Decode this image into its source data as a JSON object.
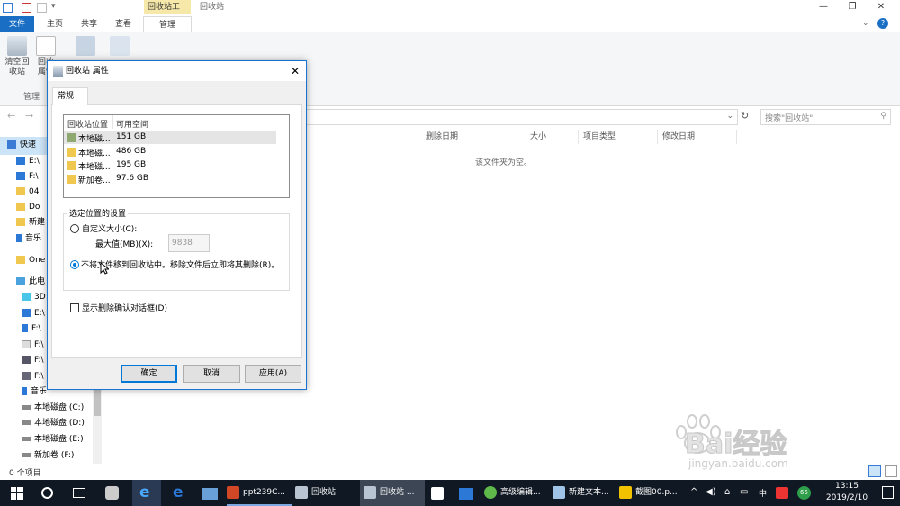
{
  "titlebar": {
    "context_tab": "回收站工具",
    "window_title": "回收站",
    "minimize": "—",
    "maximize": "❐",
    "close": "✕"
  },
  "ribbon_tabs": [
    {
      "label": "文件"
    },
    {
      "label": "主页"
    },
    {
      "label": "共享"
    },
    {
      "label": "查看"
    },
    {
      "label": "管理"
    }
  ],
  "ribbon": {
    "empty_recycle": "清空回收站",
    "empty_line1": "清空回",
    "empty_line2": "收站",
    "props_line1": "回收",
    "props_line2": "属性",
    "group_label": "管理"
  },
  "address": {
    "search_placeholder": "搜索\"回收站\""
  },
  "columns": [
    "删除日期",
    "大小",
    "项目类型",
    "修改日期"
  ],
  "empty_message": "该文件夹为空。",
  "nav": [
    {
      "label": "快速",
      "icon": "star-icon"
    },
    {
      "label": "E:\\",
      "icon": "drive-icon"
    },
    {
      "label": "F:\\",
      "icon": "drive-icon"
    },
    {
      "label": "04",
      "icon": "folder-icon"
    },
    {
      "label": "Do",
      "icon": "folder-icon"
    },
    {
      "label": "新建",
      "icon": "folder-icon"
    },
    {
      "label": "音乐",
      "icon": "music-icon"
    },
    {
      "label": "One",
      "icon": "folder-icon"
    },
    {
      "label": "此电",
      "icon": "pc-icon"
    },
    {
      "label": "3D",
      "icon": "cube-icon"
    },
    {
      "label": "E:\\",
      "icon": "drive-icon"
    },
    {
      "label": "F:\\",
      "icon": "download-icon"
    },
    {
      "label": "F:\\",
      "icon": "doc-icon"
    },
    {
      "label": "F:\\",
      "icon": "image-icon"
    },
    {
      "label": "F:\\",
      "icon": "video-icon"
    },
    {
      "label": "音乐",
      "icon": "music-icon"
    },
    {
      "label": "本地磁盘 (C:)",
      "icon": "disk-icon"
    },
    {
      "label": "本地磁盘 (D:)",
      "icon": "disk-icon"
    },
    {
      "label": "本地磁盘 (E:)",
      "icon": "disk-icon"
    },
    {
      "label": "新加卷 (F:)",
      "icon": "disk-icon"
    }
  ],
  "status_bar": {
    "count": "0 个项目"
  },
  "dialog": {
    "title": "回收站 属性",
    "tab": "常规",
    "list_headers": [
      "回收站位置",
      "可用空间"
    ],
    "locations": [
      {
        "name": "本地磁...",
        "space": "151 GB"
      },
      {
        "name": "本地磁...",
        "space": "486 GB"
      },
      {
        "name": "本地磁...",
        "space": "195 GB"
      },
      {
        "name": "新加卷...",
        "space": "97.6 GB"
      }
    ],
    "group_title": "选定位置的设置",
    "custom_size": "自定义大小(C):",
    "max_size_label": "最大值(MB)(X):",
    "max_size_value": "9838",
    "no_move": "不将文件移到回收站中。移除文件后立即将其删除(R)。",
    "confirm_dialog": "显示删除确认对话框(D)",
    "ok": "确定",
    "cancel": "取消",
    "apply": "应用(A)"
  },
  "taskbar": {
    "apps": [
      {
        "label": "ppt239C..."
      },
      {
        "label": "回收站"
      },
      {
        "label": "回收站 ..."
      },
      {
        "label": "高级编辑..."
      },
      {
        "label": "新建文本..."
      },
      {
        "label": "截图00.p..."
      }
    ],
    "ime": "中",
    "time": "13:15",
    "date": "2019/2/10",
    "badge": "65"
  },
  "watermark": {
    "brand": "Bai经验",
    "url": "jingyan.baidu.com"
  }
}
